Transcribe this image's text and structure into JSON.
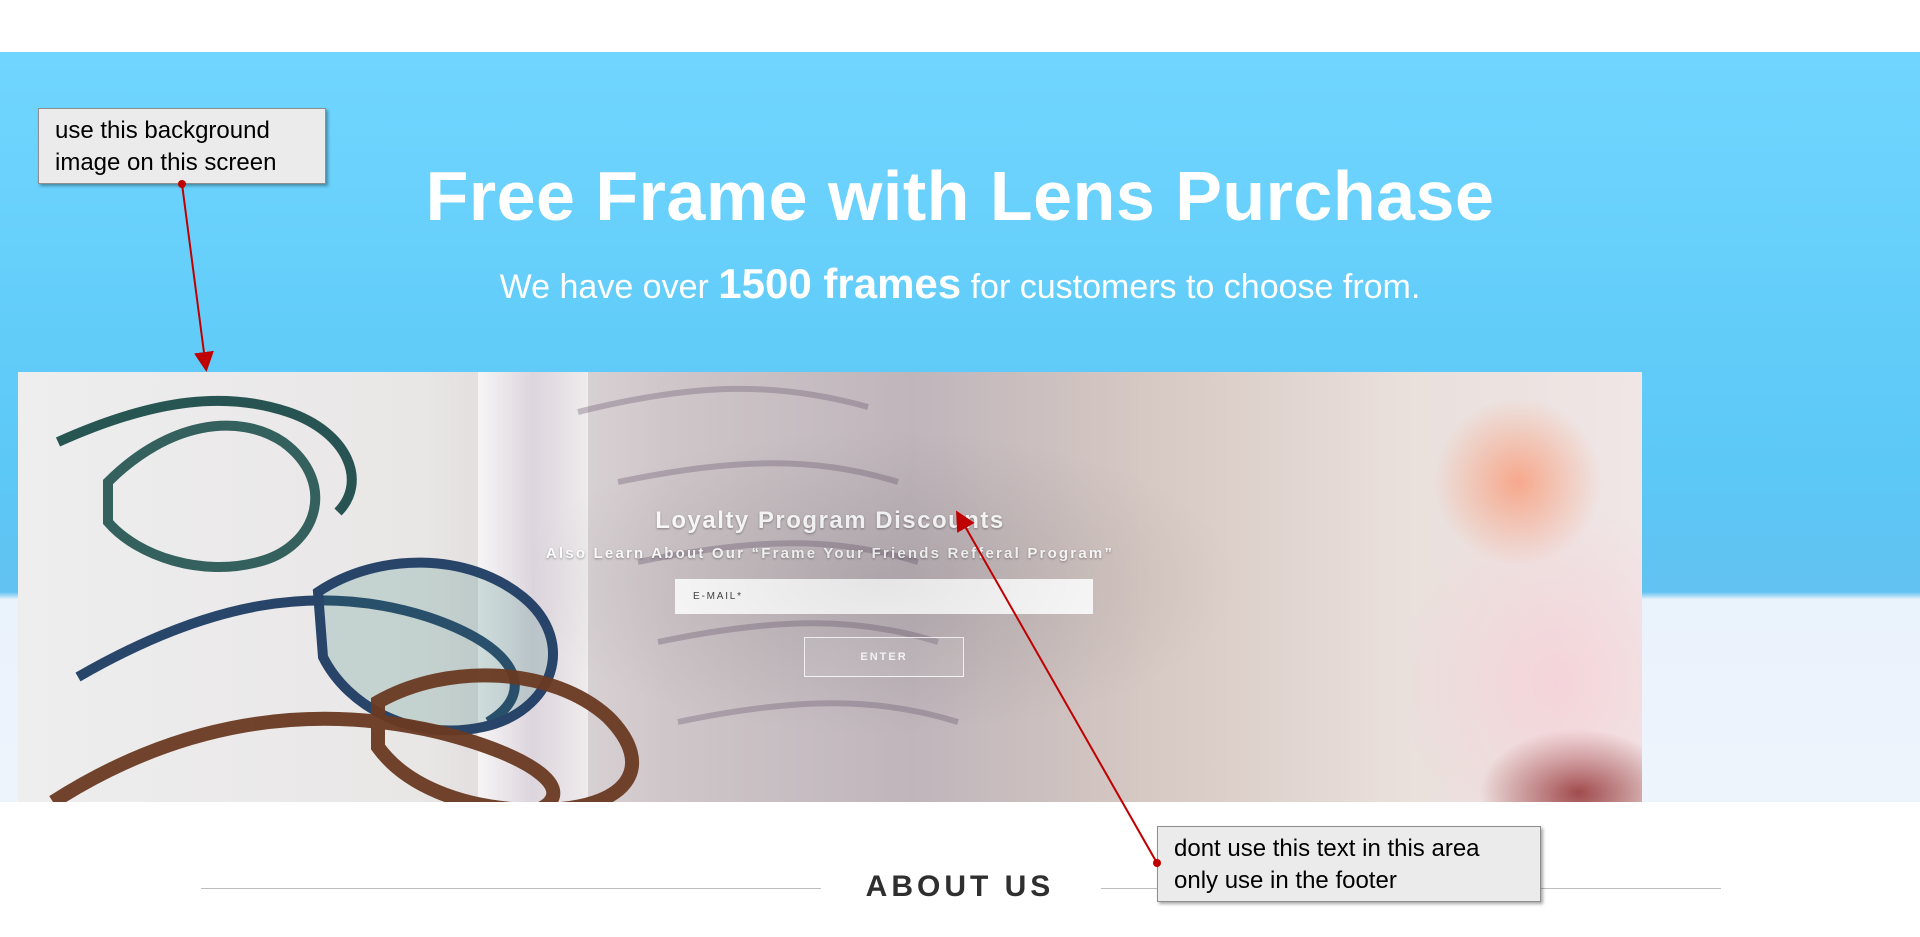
{
  "hero": {
    "title": "Free Frame with Lens Purchase",
    "subtitle_pre": "We have over",
    "subtitle_strong": "1500 frames",
    "subtitle_post": "for customers to choose from."
  },
  "promo": {
    "title": "Loyalty Program Discounts",
    "subtitle": "Also Learn About Our “Frame Your Friends Refferal Program”",
    "email_placeholder": "E-MAIL*",
    "email_value": "",
    "button_label": "ENTER"
  },
  "about": {
    "title": "ABOUT US"
  },
  "notes": [
    {
      "text": "use this background\nimage on this screen"
    },
    {
      "text": "dont use this text in this area\nonly use in the footer"
    }
  ],
  "colors": {
    "hero_blue": "#70d6ff",
    "white": "#ffffff",
    "note_bg": "#ebebeb",
    "annotation_red": "#c00000",
    "about_text": "#2f2f2f",
    "divider": "#bdbdbd"
  },
  "icons": {
    "arrow": "annotation-arrow-icon"
  }
}
